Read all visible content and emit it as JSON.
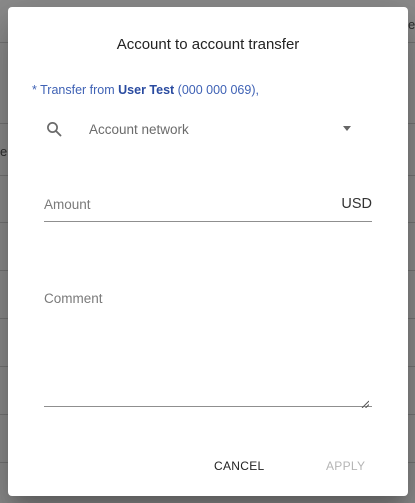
{
  "background": {
    "partial_text_right": "e",
    "partial_text_left": "e"
  },
  "dialog": {
    "title": "Account to account transfer",
    "transfer_from": {
      "prefix": "* Transfer from ",
      "user_name": "User Test",
      "account_suffix": " (000 000 069),"
    },
    "account_network": {
      "icon": "search-icon",
      "placeholder": "Account network"
    },
    "amount": {
      "label": "Amount",
      "currency": "USD"
    },
    "comment": {
      "label": "Comment"
    },
    "actions": {
      "cancel_label": "CANCEL",
      "apply_label": "APPLY"
    }
  },
  "colors": {
    "accent": "#3f62b5",
    "disabled": "#b5b5b5"
  }
}
